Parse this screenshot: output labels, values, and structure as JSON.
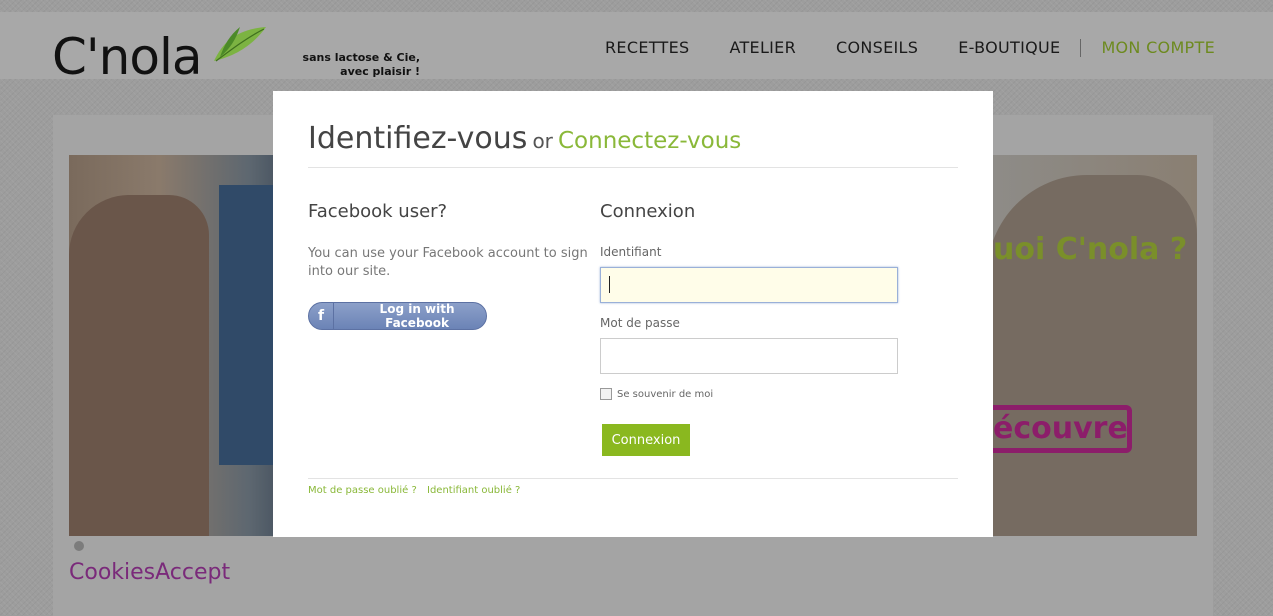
{
  "header": {
    "logo_text": "C'nola",
    "tagline_line1": "sans lactose & Cie,",
    "tagline_line2": "avec plaisir !",
    "nav": [
      "RECETTES",
      "ATELIER",
      "CONSEILS",
      "E-BOUTIQUE"
    ],
    "account": "MON COMPTE"
  },
  "hero": {
    "title": "uoi C'nola ?",
    "button": "écouvre"
  },
  "cookies": "CookiesAccept",
  "modal": {
    "title_main": "Identifiez-vous",
    "title_or": "or",
    "title_alt": "Connectez-vous",
    "facebook": {
      "heading": "Facebook user?",
      "text": "You can use your Facebook account to sign into our site.",
      "button": "Log in with Facebook"
    },
    "login": {
      "heading": "Connexion",
      "username_label": "Identifiant",
      "username_value": "",
      "password_label": "Mot de passe",
      "password_value": "",
      "remember": "Se souvenir de moi",
      "submit": "Connexion"
    },
    "links": {
      "forgot_password": "Mot de passe oublié ?",
      "forgot_username": "Identifiant oublié ?"
    }
  },
  "colors": {
    "accent_green": "#8ab839",
    "brand_purple": "#8c1d6a",
    "facebook_blue": "#6b83b6"
  }
}
